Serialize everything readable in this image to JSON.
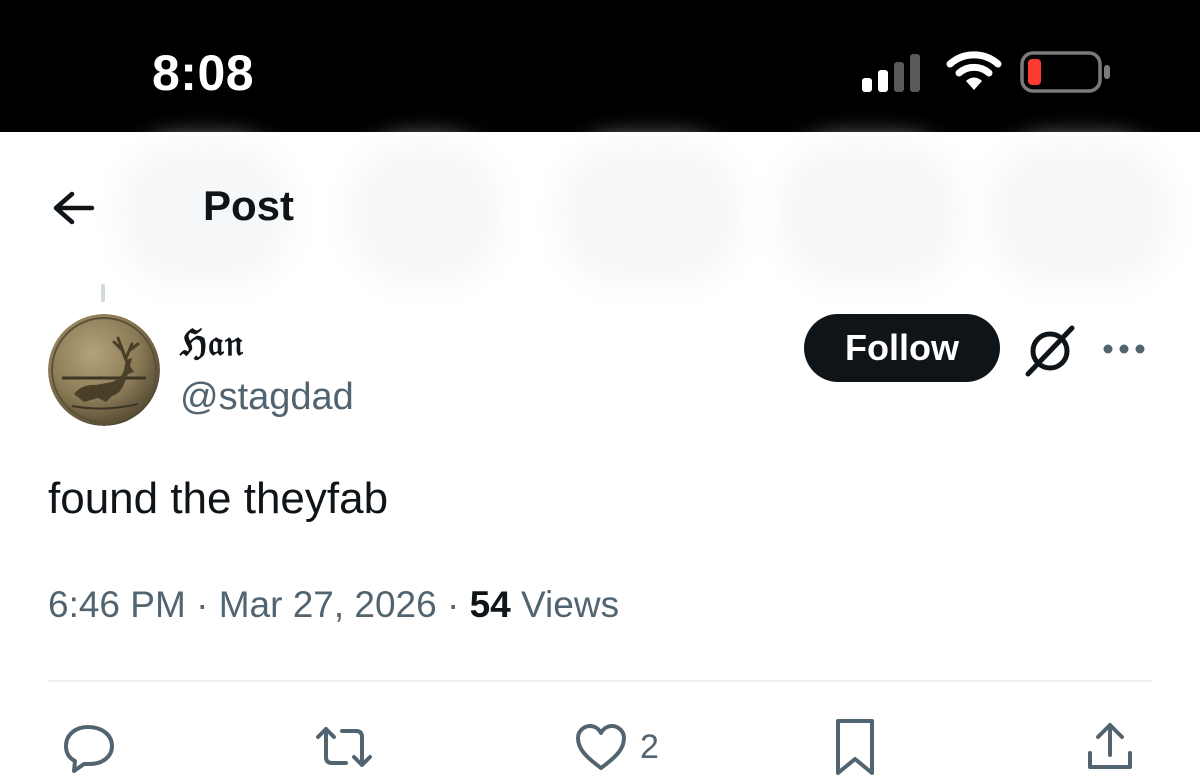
{
  "status_bar": {
    "time": "8:08",
    "signal_bars": 4,
    "signal_bars_active": 2,
    "battery_level": 0.1,
    "battery_color": "#ff3b30"
  },
  "header": {
    "back_icon": "arrow-left-icon",
    "title": "Post"
  },
  "post": {
    "author": {
      "display_name": "Han",
      "display_name_rendered": "ℌ𝔞𝔫",
      "handle": "@stagdad",
      "avatar": "stag-medallion-avatar"
    },
    "follow_label": "Follow",
    "grok_icon": "grok-icon",
    "more_icon": "more-horizontal-icon",
    "text": "found the theyfab",
    "time": "6:46 PM",
    "separator": "·",
    "date": "Mar 27, 2026",
    "views_count": "54",
    "views_label": "Views"
  },
  "actions": {
    "reply_icon": "reply-icon",
    "repost_icon": "repost-icon",
    "like_icon": "heart-icon",
    "like_count": "2",
    "bookmark_icon": "bookmark-icon",
    "share_icon": "share-icon"
  },
  "colors": {
    "primary_text": "#0f1419",
    "secondary_text": "#536471",
    "divider": "#eff3f4",
    "status_bar_bg": "#000000"
  }
}
